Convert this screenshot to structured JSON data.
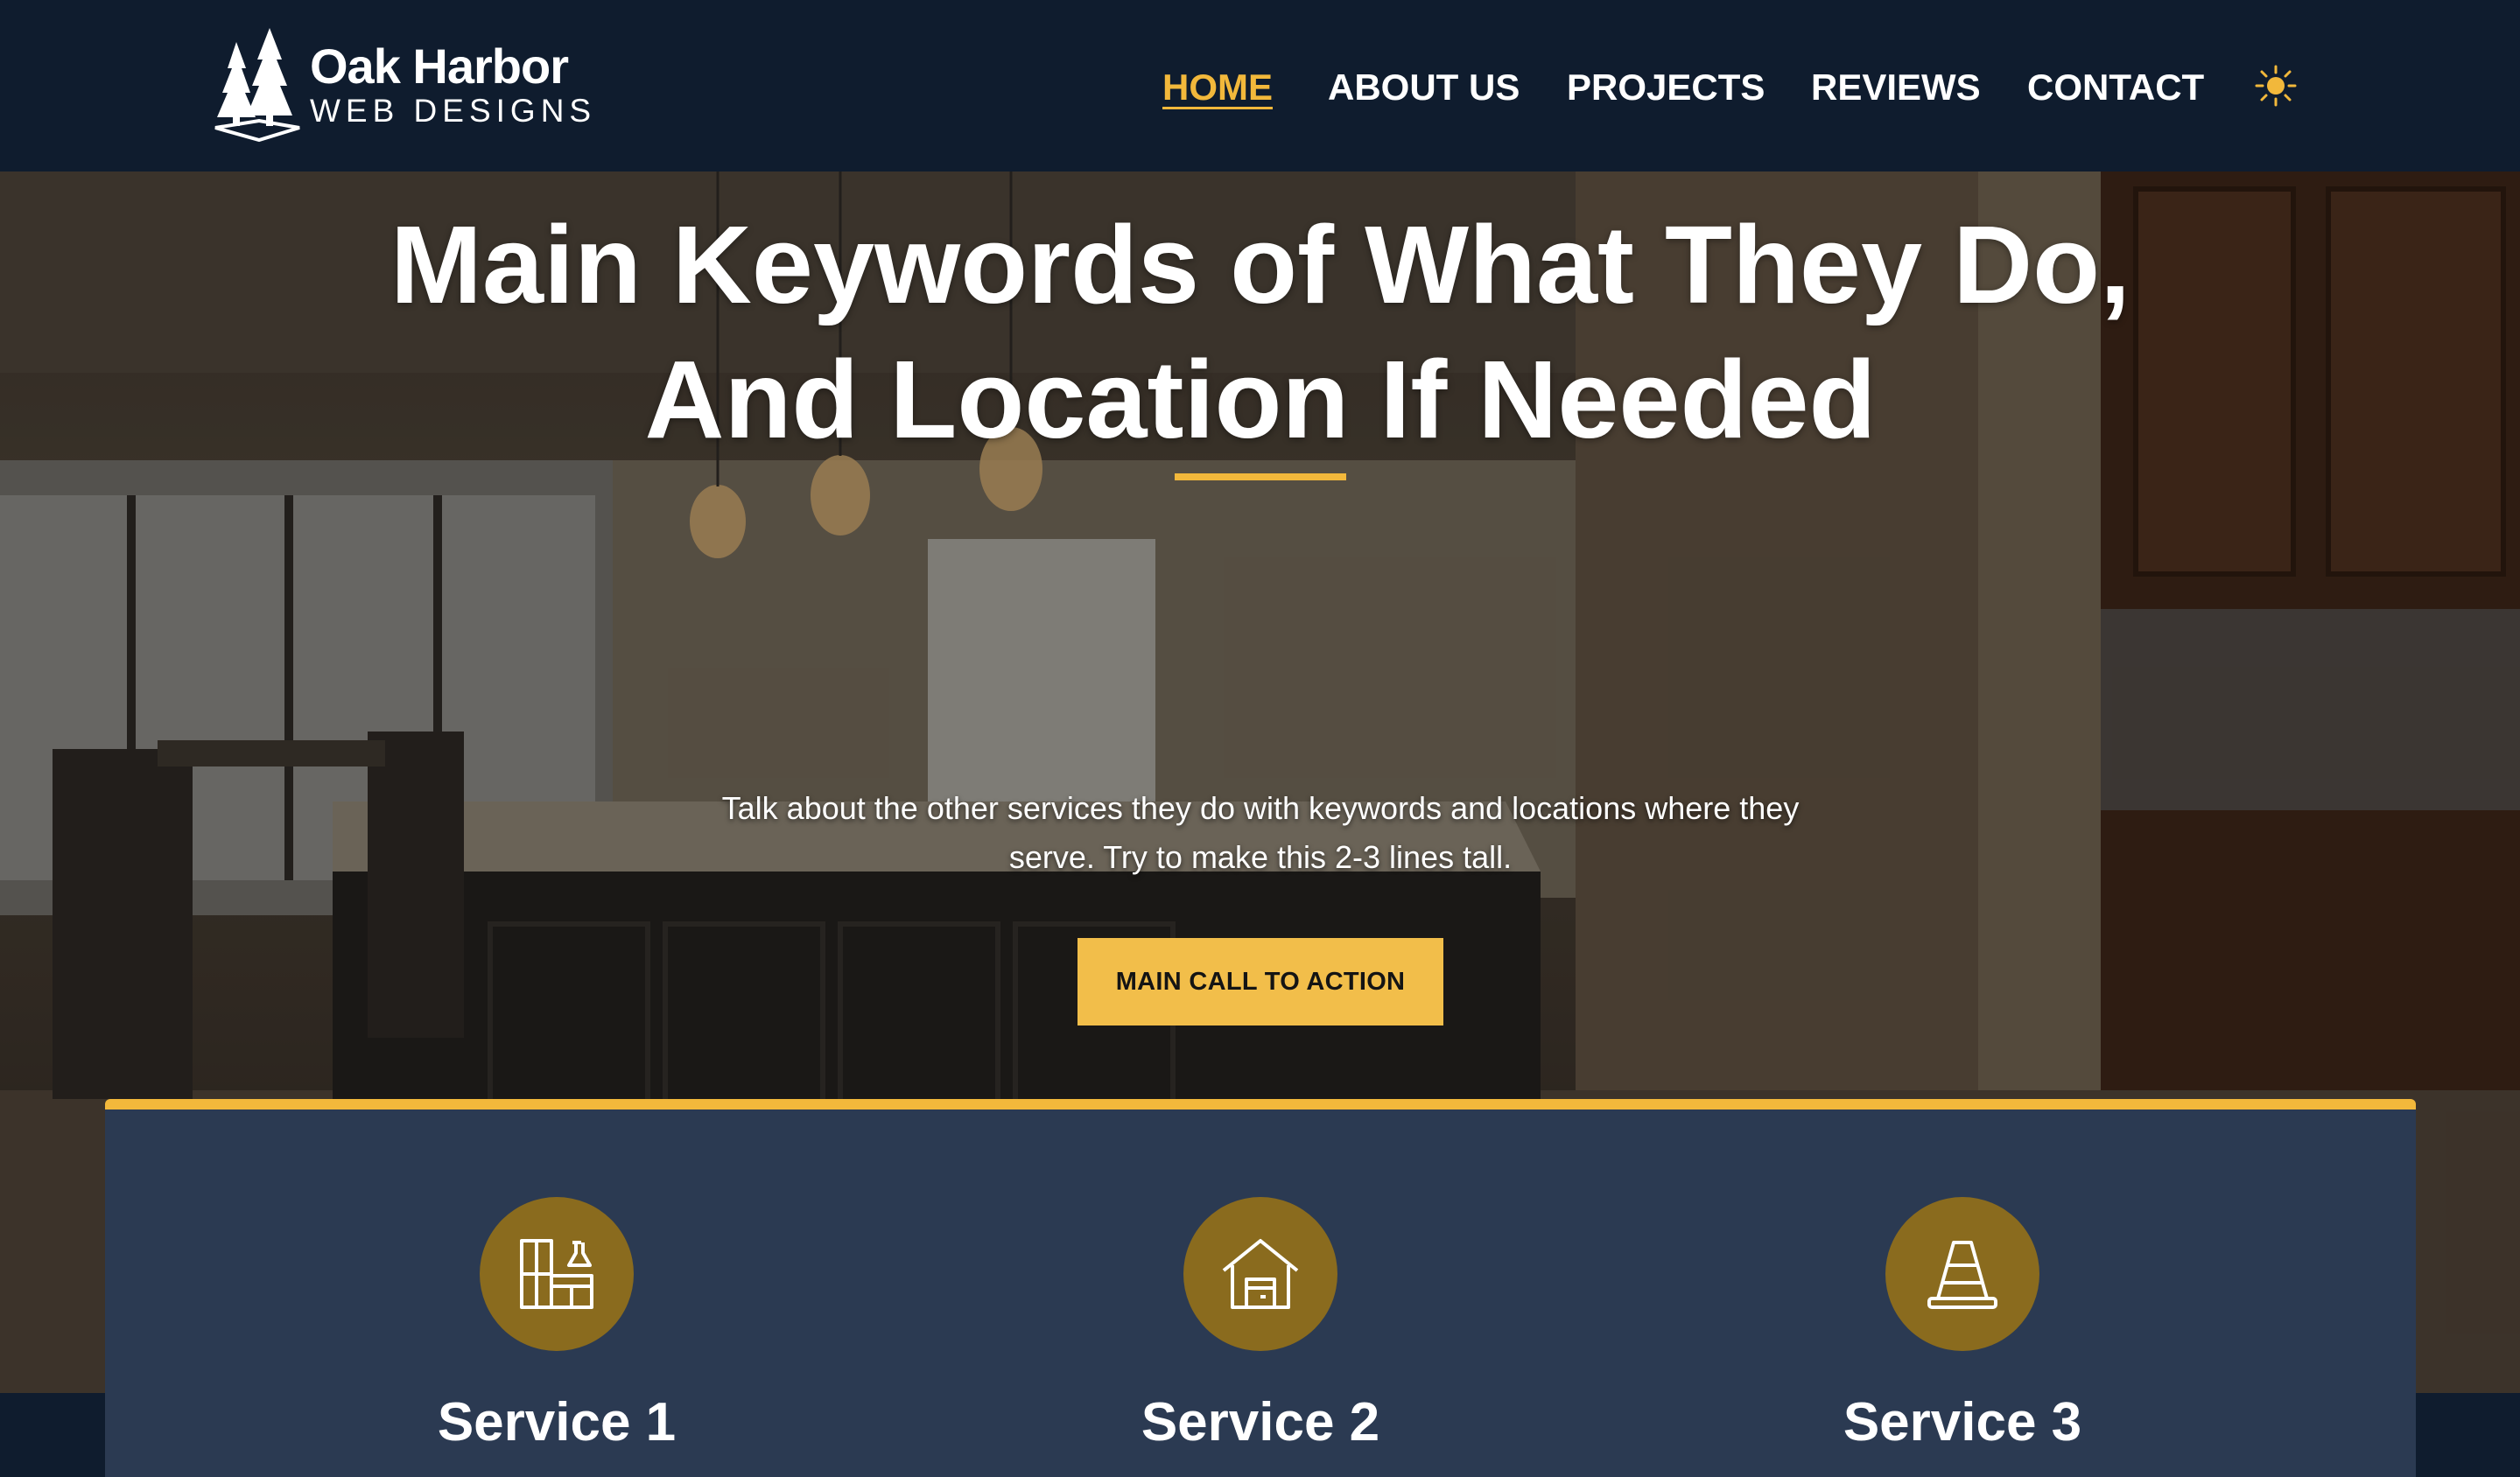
{
  "brand": {
    "name_line1": "Oak Harbor",
    "name_line2": "WEB DESIGNS"
  },
  "nav": {
    "items": [
      {
        "label": "HOME",
        "active": true
      },
      {
        "label": "ABOUT US",
        "active": false
      },
      {
        "label": "PROJECTS",
        "active": false
      },
      {
        "label": "REVIEWS",
        "active": false
      },
      {
        "label": "CONTACT",
        "active": false
      }
    ],
    "theme_toggle_icon": "sun-icon"
  },
  "hero": {
    "title": "Main Keywords of What They Do, And Location If Needed",
    "subtitle": "Talk about the other services they do with keywords and locations where they serve. Try to make this 2-3 lines tall.",
    "cta_label": "MAIN CALL TO ACTION"
  },
  "services": [
    {
      "title": "Service 1",
      "icon": "kitchen-cabinets-icon"
    },
    {
      "title": "Service 2",
      "icon": "garage-house-icon"
    },
    {
      "title": "Service 3",
      "icon": "traffic-cone-icon"
    }
  ],
  "colors": {
    "header_bg": "#0f1c2e",
    "accent": "#f2b83b",
    "panel_bg": "#2b3a52",
    "icon_circle": "#8a6b1e",
    "text": "#ffffff"
  }
}
